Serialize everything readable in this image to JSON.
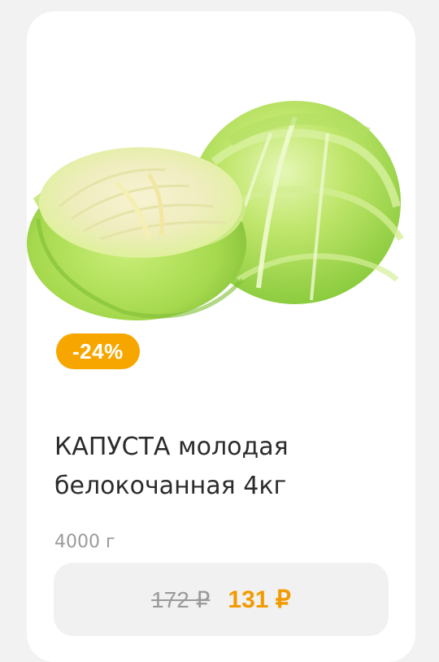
{
  "product": {
    "image_icon": "cabbage-image",
    "discount": "-24%",
    "title": "КАПУСТА молодая белокочанная 4кг",
    "weight": "4000 г",
    "old_price": "172 ₽",
    "new_price": "131 ₽"
  },
  "colors": {
    "background": "#f2f2f2",
    "card": "#ffffff",
    "badge": "#f7a600",
    "accent_price": "#f29b00",
    "muted_text": "#9a9a9a"
  }
}
